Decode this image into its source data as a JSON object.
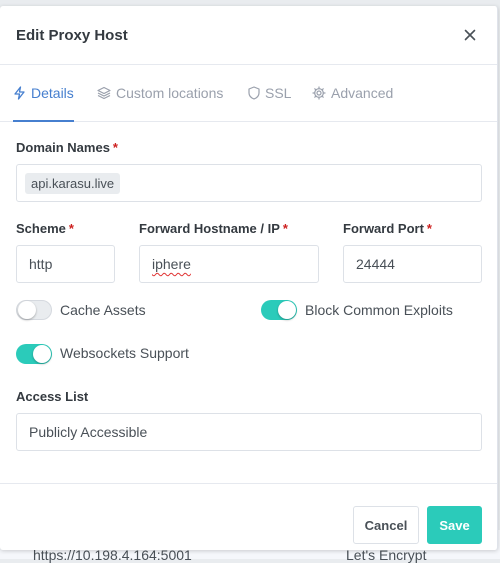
{
  "background": {
    "url_text": "https://10.198.4.164:5001",
    "ssl_text": "Let's Encrypt"
  },
  "modal": {
    "title": "Edit Proxy Host",
    "close_label": "×"
  },
  "tabs": [
    {
      "label": "Details",
      "icon": "bolt-icon",
      "active": true
    },
    {
      "label": "Custom locations",
      "icon": "layers-icon",
      "active": false
    },
    {
      "label": "SSL",
      "icon": "shield-icon",
      "active": false
    },
    {
      "label": "Advanced",
      "icon": "gear-icon",
      "active": false
    }
  ],
  "form": {
    "domain_names": {
      "label": "Domain Names",
      "chips": [
        "api.karasu.live"
      ]
    },
    "scheme": {
      "label": "Scheme",
      "value": "http"
    },
    "forward_host": {
      "label": "Forward Hostname / IP",
      "value": "iphere"
    },
    "forward_port": {
      "label": "Forward Port",
      "value": "24444"
    },
    "required_mark": "*",
    "cache_assets": {
      "label": "Cache Assets",
      "enabled": false
    },
    "block_exploits": {
      "label": "Block Common Exploits",
      "enabled": true
    },
    "websockets": {
      "label": "Websockets Support",
      "enabled": true
    },
    "access_list": {
      "label": "Access List",
      "value": "Publicly Accessible"
    }
  },
  "footer": {
    "cancel_label": "Cancel",
    "save_label": "Save"
  },
  "colors": {
    "accent": "#467fcf",
    "teal": "#2bcbba",
    "required": "#cd201f"
  }
}
